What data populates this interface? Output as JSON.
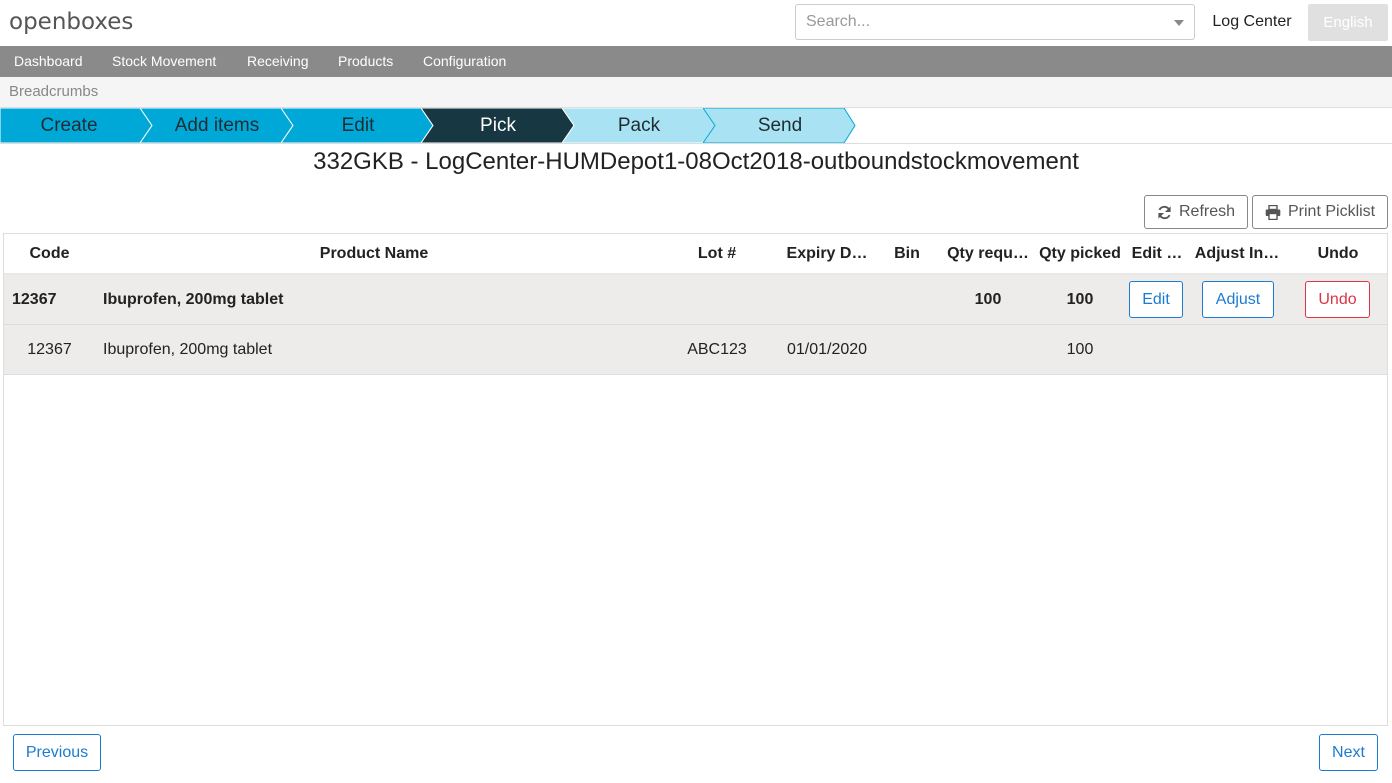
{
  "app": {
    "logo": "openboxes",
    "search_placeholder": "Search...",
    "location": "Log Center",
    "language": "English"
  },
  "menu": {
    "items": [
      "Dashboard",
      "Stock Movement",
      "Receiving",
      "Products",
      "Configuration"
    ]
  },
  "breadcrumbs": "Breadcrumbs",
  "wizard": {
    "steps": [
      {
        "label": "Create",
        "state": "done"
      },
      {
        "label": "Add items",
        "state": "done"
      },
      {
        "label": "Edit",
        "state": "done"
      },
      {
        "label": "Pick",
        "state": "active"
      },
      {
        "label": "Pack",
        "state": "todo"
      },
      {
        "label": "Send",
        "state": "todo"
      }
    ]
  },
  "title": "332GKB - LogCenter-HUMDepot1-08Oct2018-outboundstockmovement",
  "toolbar": {
    "refresh_label": "Refresh",
    "print_label": "Print Picklist",
    "refresh_icon": "refresh-icon",
    "print_icon": "printer-icon"
  },
  "table": {
    "columns": [
      "Code",
      "Product Name",
      "Lot #",
      "Expiry D…",
      "Bin",
      "Qty requ…",
      "Qty picked",
      "Edit …",
      "Adjust In…",
      "Undo"
    ],
    "rows": [
      {
        "code": "12367",
        "product": "Ibuprofen, 200mg tablet",
        "lot": "",
        "expiry": "",
        "bin": "",
        "qty_requested": "100",
        "qty_picked": "100",
        "edit_label": "Edit",
        "adjust_label": "Adjust",
        "undo_label": "Undo"
      },
      {
        "code": "12367",
        "product": "Ibuprofen, 200mg tablet",
        "lot": "ABC123",
        "expiry": "01/01/2020",
        "bin": "",
        "qty_requested": "",
        "qty_picked": "100"
      }
    ]
  },
  "footer": {
    "previous_label": "Previous",
    "next_label": "Next"
  },
  "colors": {
    "step_done": "#00a8d8",
    "step_active": "#173742",
    "step_todo": "#a9e3f3",
    "link_blue": "#1a7bd1",
    "danger_red": "#dc3545",
    "menu_bg": "#8a8a8a",
    "row_bg": "#eeebeb"
  }
}
